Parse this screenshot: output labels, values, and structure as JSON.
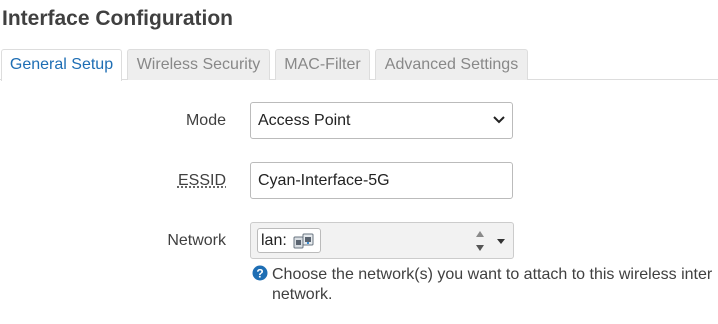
{
  "page": {
    "title": "Interface Configuration"
  },
  "tabs": [
    {
      "label": "General Setup",
      "active": true
    },
    {
      "label": "Wireless Security",
      "active": false
    },
    {
      "label": "MAC-Filter",
      "active": false
    },
    {
      "label": "Advanced Settings",
      "active": false
    }
  ],
  "form": {
    "mode": {
      "label": "Mode",
      "value": "Access Point"
    },
    "essid": {
      "label": "ESSID",
      "value": "Cyan-Interface-5G"
    },
    "network": {
      "label": "Network",
      "selected": "lan:",
      "selected_icon": "ethernet-ports-icon",
      "help_line1": "Choose the network(s) you want to attach to this wireless inter",
      "help_line2": "network."
    }
  },
  "colors": {
    "active_tab_text": "#1e6eb4",
    "inactive_tab_bg": "#eeeeee",
    "help_icon": "#1e6eb4"
  }
}
